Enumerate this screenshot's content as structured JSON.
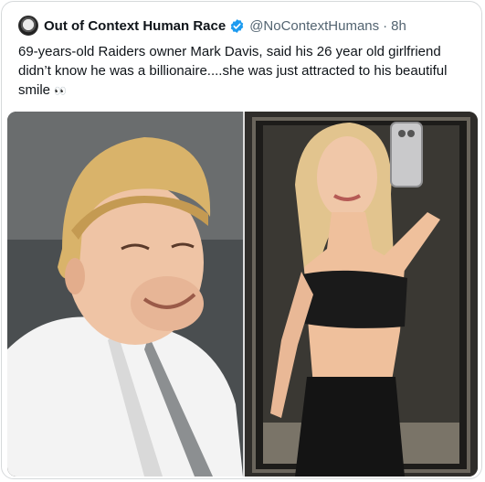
{
  "tweet": {
    "display_name": "Out of Context Human Race",
    "handle": "@NoContextHumans",
    "separator": "·",
    "time": "8h",
    "text": "69-years-old Raiders owner Mark Davis, said his 26 year old girlfriend didn’t know he was a billionaire....she was just attracted to his beautiful smile",
    "emoji": "👀"
  },
  "icons": {
    "avatar": "avatar-image",
    "verified": "verified-badge-icon"
  },
  "colors": {
    "verified_blue": "#1d9bf0",
    "handle_gray": "#536471",
    "border": "#d6d9db"
  },
  "media": {
    "count": 2,
    "images": [
      {
        "subject": "smiling older man with blond bowl haircut in white jacket"
      },
      {
        "subject": "woman taking mirror selfie in black top and skirt"
      }
    ]
  }
}
